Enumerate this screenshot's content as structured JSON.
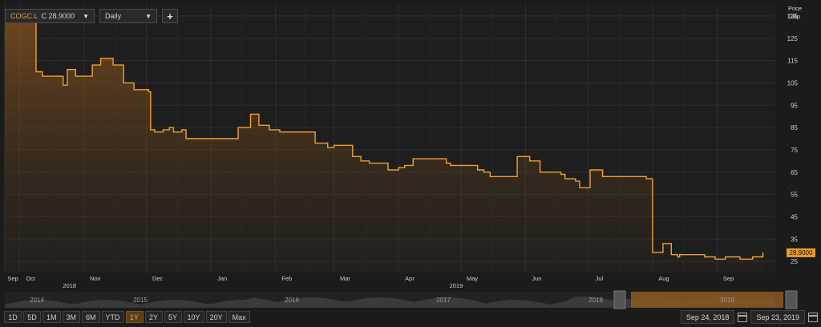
{
  "toolbar": {
    "ticker": "COGC.L",
    "quote": "C 28.9000",
    "interval": "Daily",
    "add_label": "+"
  },
  "price_axis": {
    "title_line1": "Price",
    "title_line2": "GBp"
  },
  "last_price_label": "28.9000",
  "navigator_years": [
    "2014",
    "2015",
    "2016",
    "2017",
    "2018",
    "2019"
  ],
  "range_buttons": [
    "1D",
    "5D",
    "1M",
    "3M",
    "6M",
    "YTD",
    "1Y",
    "2Y",
    "5Y",
    "10Y",
    "20Y",
    "Max"
  ],
  "active_range": "1Y",
  "date_range": {
    "start": "Sep 24, 2018",
    "end": "Sep 23, 2019"
  },
  "colors": {
    "line": "#f0a030",
    "background": "#1b1b1b",
    "grid": "#2e2e2e"
  },
  "chart_data": {
    "type": "area",
    "title": "",
    "xlabel": "",
    "ylabel": "Price GBp",
    "ylim": [
      20,
      140
    ],
    "yticks": [
      25,
      35,
      45,
      55,
      65,
      75,
      85,
      95,
      105,
      115,
      125,
      135
    ],
    "xticks": [
      "Sep",
      "Oct",
      "Nov",
      "Dec",
      "Jan",
      "Feb",
      "Mar",
      "Apr",
      "May",
      "Jun",
      "Jul",
      "Aug",
      "Sep"
    ],
    "year_labels": [
      "2018",
      "2019"
    ],
    "grid": true,
    "series": [
      {
        "name": "COGC.L",
        "x": [
          "2018-09-24",
          "2018-09-26",
          "2018-10-05",
          "2018-10-09",
          "2018-10-12",
          "2018-10-22",
          "2018-10-24",
          "2018-10-28",
          "2018-10-30",
          "2018-11-01",
          "2018-11-05",
          "2018-11-09",
          "2018-11-15",
          "2018-11-20",
          "2018-11-25",
          "2018-12-02",
          "2018-12-03",
          "2018-12-05",
          "2018-12-07",
          "2018-12-09",
          "2018-12-12",
          "2018-12-14",
          "2018-12-18",
          "2018-12-20",
          "2018-12-24",
          "2018-12-26",
          "2019-01-02",
          "2019-01-07",
          "2019-01-14",
          "2019-01-20",
          "2019-01-24",
          "2019-01-27",
          "2019-01-29",
          "2019-01-31",
          "2019-02-03",
          "2019-02-07",
          "2019-02-09",
          "2019-02-12",
          "2019-02-15",
          "2019-02-20",
          "2019-02-26",
          "2019-03-01",
          "2019-03-03",
          "2019-03-05",
          "2019-03-10",
          "2019-03-14",
          "2019-03-18",
          "2019-03-22",
          "2019-03-27",
          "2019-04-01",
          "2019-04-04",
          "2019-04-08",
          "2019-04-11",
          "2019-04-15",
          "2019-04-21",
          "2019-04-24",
          "2019-04-26",
          "2019-05-01",
          "2019-05-03",
          "2019-05-09",
          "2019-05-12",
          "2019-05-15",
          "2019-05-20",
          "2019-05-28",
          "2019-06-03",
          "2019-06-06",
          "2019-06-08",
          "2019-06-11",
          "2019-06-13",
          "2019-06-16",
          "2019-06-18",
          "2019-06-20",
          "2019-06-25",
          "2019-06-27",
          "2019-07-02",
          "2019-07-08",
          "2019-07-12",
          "2019-07-15",
          "2019-07-17",
          "2019-07-20",
          "2019-07-23",
          "2019-07-26",
          "2019-07-29",
          "2019-08-01",
          "2019-08-06",
          "2019-08-10",
          "2019-08-13",
          "2019-08-14",
          "2019-08-16",
          "2019-08-18",
          "2019-08-23",
          "2019-08-26",
          "2019-08-31",
          "2019-09-05",
          "2019-09-12",
          "2019-09-15",
          "2019-09-18",
          "2019-09-23"
        ],
        "y": [
          137,
          136,
          136,
          110,
          108,
          104,
          111,
          108,
          108,
          108,
          113,
          116,
          113,
          105,
          102,
          101,
          84,
          83,
          83,
          84,
          85,
          83,
          84,
          80,
          80,
          80,
          80,
          80,
          85,
          91,
          86,
          86,
          84,
          84,
          83,
          83,
          83,
          83,
          83,
          78,
          76,
          77,
          77,
          77,
          72,
          70,
          69,
          69,
          66,
          67,
          68,
          71,
          71,
          71,
          71,
          69,
          68,
          68,
          68,
          66,
          65,
          63,
          63,
          72,
          70,
          70,
          65,
          65,
          65,
          65,
          64,
          62,
          61,
          58,
          66,
          63,
          63,
          63,
          63,
          63,
          63,
          63,
          62,
          29,
          33,
          28,
          27,
          28,
          28,
          28,
          28,
          27,
          26,
          27,
          26,
          26,
          27,
          29
        ]
      }
    ]
  }
}
